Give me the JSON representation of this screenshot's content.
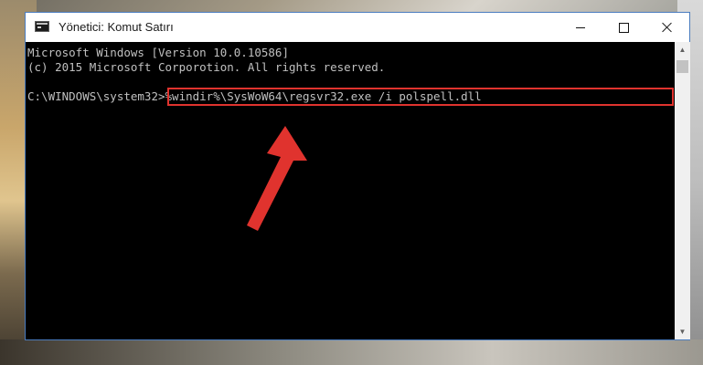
{
  "window": {
    "title": "Yönetici: Komut Satırı",
    "buttons": {
      "minimize": "minimize-icon",
      "maximize": "maximize-icon",
      "close": "close-icon"
    }
  },
  "console": {
    "lines": [
      "Microsoft Windows [Version 10.0.10586]",
      "(c) 2015 Microsoft Corporotion. All rights reserved.",
      "C:\\WINDOWS\\system32>%windir%\\SysWoW64\\regsvr32.exe /i polspell.dll"
    ],
    "highlight_color": "#e0332e",
    "text_color": "#c0c0c0",
    "background": "#000000"
  },
  "annotation": {
    "arrow_color": "#e0332e",
    "arrow_icon": "red-arrow-pointing-up"
  },
  "scrollbar": {
    "up_icon": "scroll-up-arrow-icon",
    "down_icon": "scroll-down-arrow-icon"
  }
}
